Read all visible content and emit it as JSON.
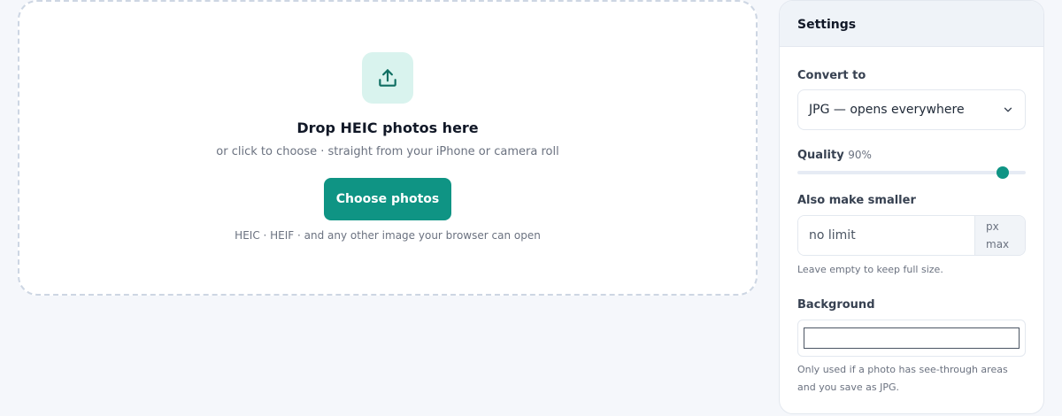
{
  "dropzone": {
    "icon": "upload-icon",
    "title": "Drop HEIC photos here",
    "subtitle": "or click to choose · straight from your iPhone or camera roll",
    "button_label": "Choose photos",
    "note": "HEIC · HEIF · and any other image your browser can open"
  },
  "settings": {
    "title": "Settings",
    "convert_to": {
      "label": "Convert to",
      "selected": "JPG — opens everywhere"
    },
    "quality": {
      "label": "Quality",
      "value_text": "90%",
      "value": 90,
      "min": 0,
      "max": 100
    },
    "resize": {
      "label": "Also make smaller",
      "placeholder": "no limit",
      "unit_line1": "px",
      "unit_line2": "max",
      "help": "Leave empty to keep full size."
    },
    "background": {
      "label": "Background",
      "color": "#ffffff",
      "help_line1": "Only used if a photo has see-through areas",
      "help_line2": "and you save as JPG."
    }
  },
  "colors": {
    "accent": "#0f9484",
    "accent_soft": "#d9f3ee"
  }
}
